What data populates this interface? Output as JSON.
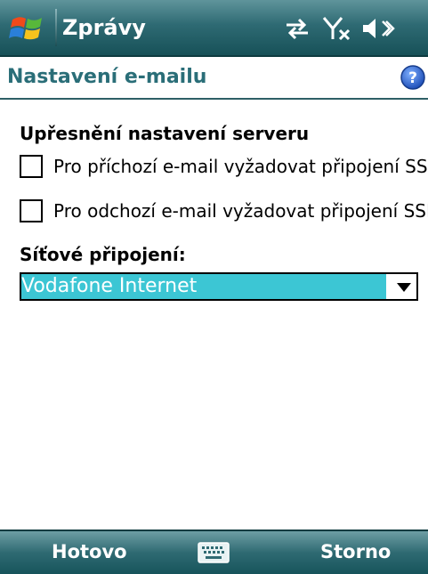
{
  "titlebar": {
    "app_title": "Zprávy"
  },
  "page": {
    "title": "Nastavení e-mailu"
  },
  "settings": {
    "section_heading": "Upřesnění nastavení serveru",
    "incoming_ssl": {
      "label": "Pro příchozí e-mail vyžadovat připojení SSL",
      "checked": false
    },
    "outgoing_ssl": {
      "label": "Pro odchozí e-mail vyžadovat připojení SSL",
      "checked": false
    },
    "network_label": "Síťové připojení:",
    "network_value": "Vodafone Internet"
  },
  "softkeys": {
    "left": "Hotovo",
    "right": "Storno"
  },
  "icons": {
    "start": "windows-start-icon",
    "sync": "sync-arrows-icon",
    "signal": "signal-off-icon",
    "volume": "volume-muted-icon",
    "help": "help-icon",
    "keyboard": "keyboard-icon",
    "dropdown": "chevron-down-icon"
  },
  "colors": {
    "bar_accent": "#2e6a73",
    "title_text": "#2a6e78",
    "selection": "#3cc6d4"
  }
}
